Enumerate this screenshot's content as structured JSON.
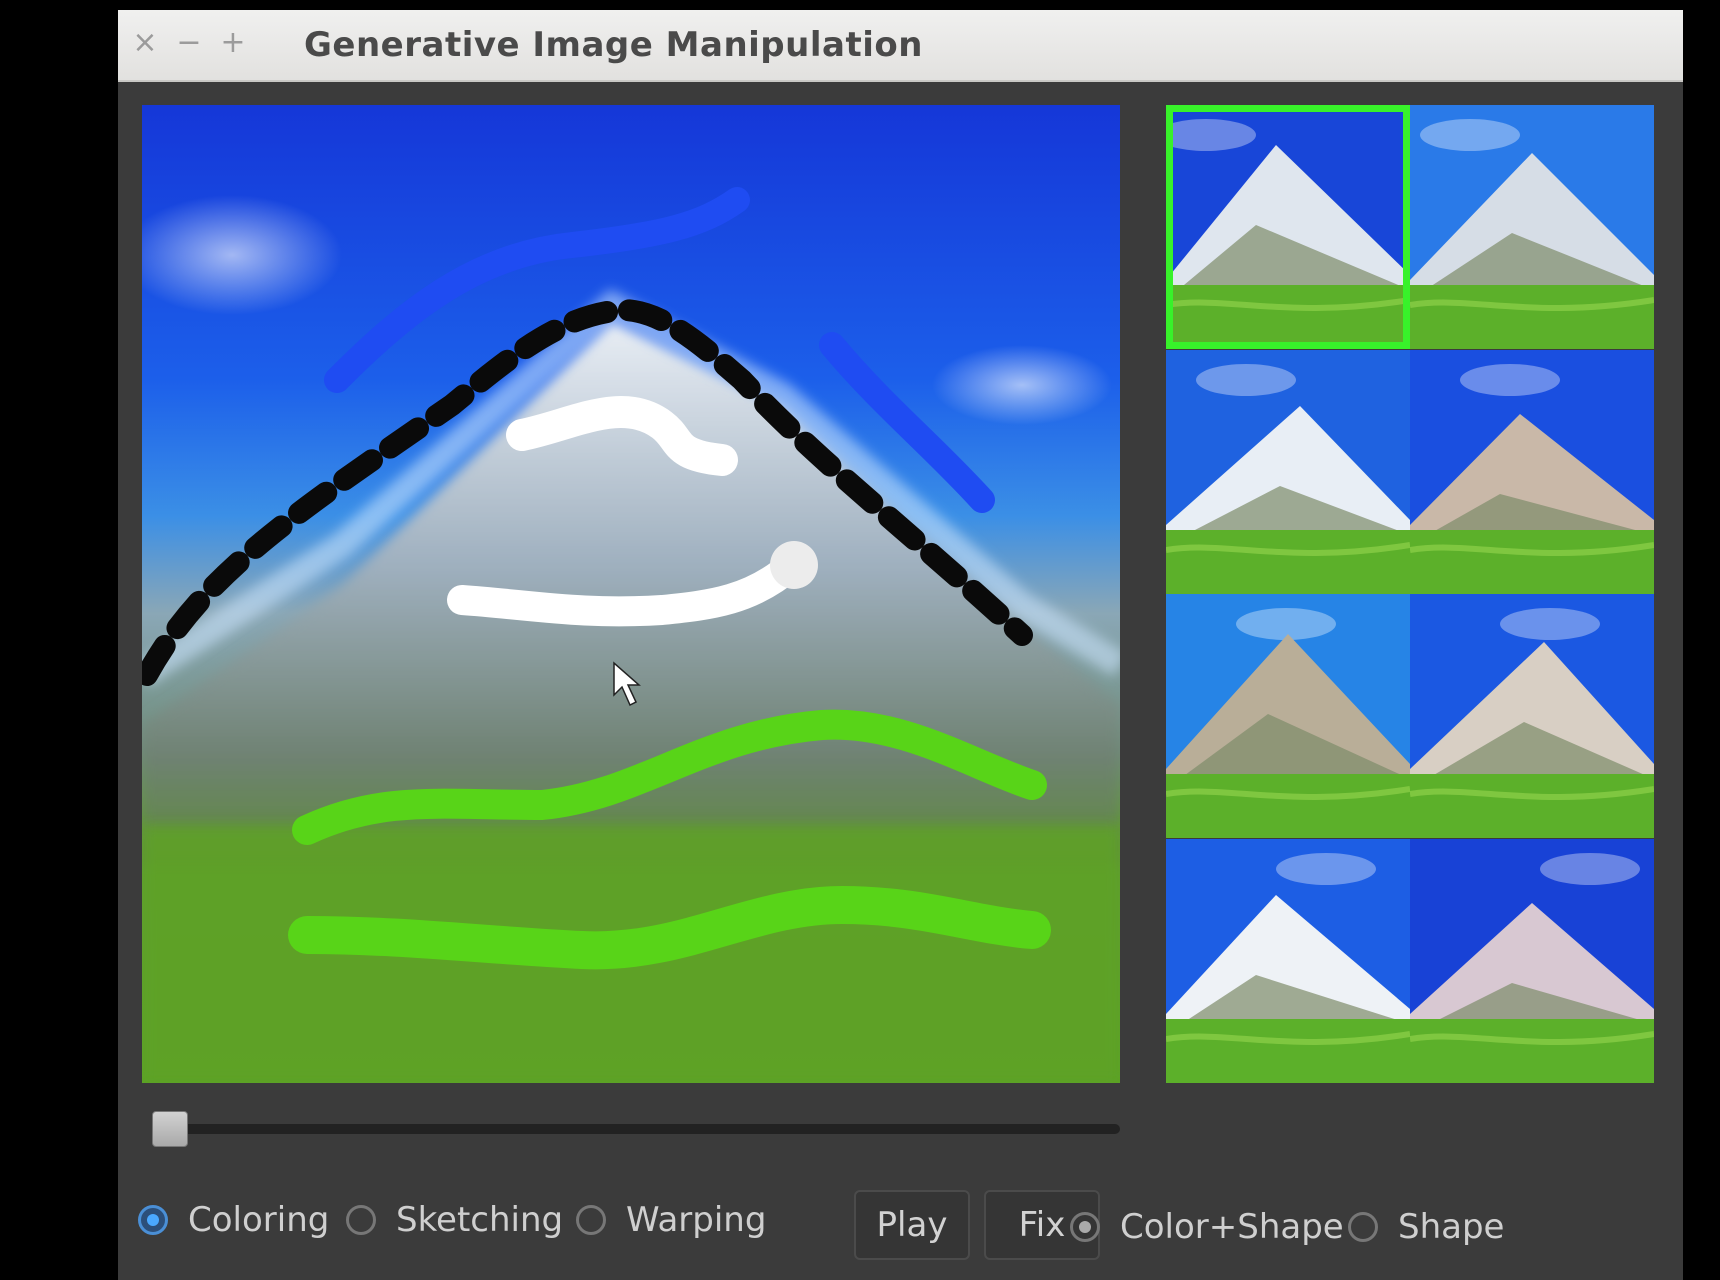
{
  "window": {
    "title": "Generative Image Manipulation",
    "controls": [
      "×",
      "−",
      "+"
    ]
  },
  "modes": [
    {
      "label": "Coloring",
      "selected": true
    },
    {
      "label": "Sketching",
      "selected": false
    },
    {
      "label": "Warping",
      "selected": false
    }
  ],
  "buttons": {
    "play": "Play",
    "fix": "Fix"
  },
  "constraint_options": [
    {
      "label": "Color+Shape",
      "selected": true
    },
    {
      "label": "Shape",
      "selected": false
    }
  ],
  "slider": {
    "value": 0
  },
  "gallery": {
    "count": 8,
    "selected_index": 0
  },
  "colors": {
    "selection_outline": "#38f22a",
    "stroke_blue": "#1f4cf2",
    "stroke_green": "#58d418",
    "stroke_white": "#ffffff",
    "stroke_black": "#0a0a0a"
  }
}
